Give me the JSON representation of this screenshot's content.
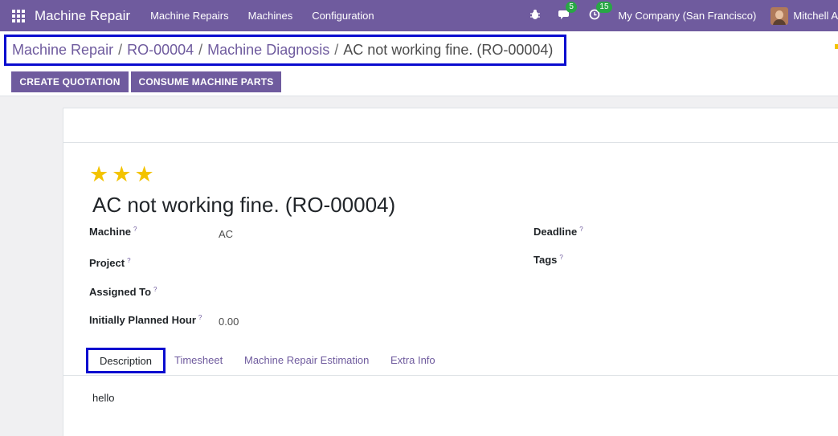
{
  "navbar": {
    "app_name": "Machine Repair",
    "menu": [
      "Machine Repairs",
      "Machines",
      "Configuration"
    ],
    "messages_badge": "5",
    "activities_badge": "15",
    "company": "My Company (San Francisco)",
    "user": "Mitchell A",
    "icons": [
      "apps-grid-icon",
      "bug-icon",
      "chat-icon",
      "clock-icon"
    ]
  },
  "breadcrumb": {
    "items": [
      "Machine Repair",
      "RO-00004",
      "Machine Diagnosis"
    ],
    "current": "AC not working fine. (RO-00004)"
  },
  "actions": {
    "create_quotation": "CREATE QUOTATION",
    "consume_parts": "CONSUME MACHINE PARTS"
  },
  "form": {
    "priority_stars": 3,
    "title": "AC not working fine. (RO-00004)",
    "fields": {
      "machine_label": "Machine",
      "machine_value": "AC",
      "project_label": "Project",
      "assigned_label": "Assigned To",
      "planned_label": "Initially Planned Hour",
      "planned_value": "0.00",
      "deadline_label": "Deadline",
      "tags_label": "Tags",
      "help_mark": "?"
    },
    "tabs": [
      "Description",
      "Timesheet",
      "Machine Repair Estimation",
      "Extra Info"
    ],
    "description_text": "hello"
  },
  "colors": {
    "navbar": "#6f5b9e",
    "primary_button": "#6f5b9e",
    "star": "#f3c300",
    "highlight_box": "#0a0ccf",
    "badge": "#28a745"
  }
}
